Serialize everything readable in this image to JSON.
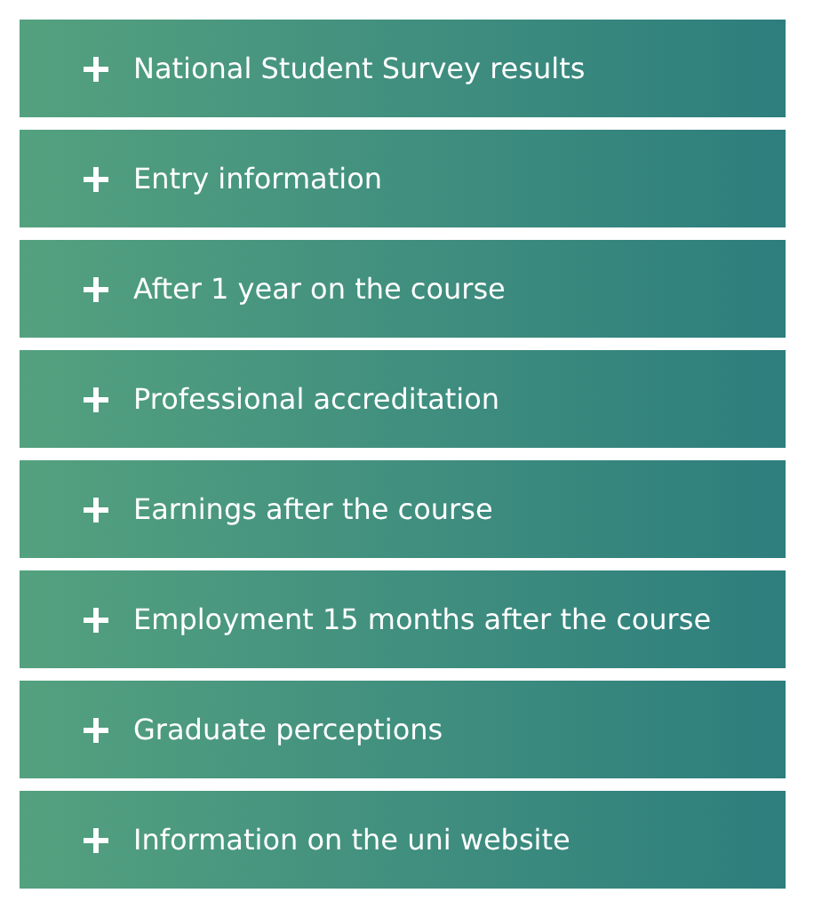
{
  "accordion": [
    {
      "label": "National Student Survey results",
      "expanded": false
    },
    {
      "label": "Entry information",
      "expanded": false
    },
    {
      "label": "After 1 year on the course",
      "expanded": false
    },
    {
      "label": "Professional accreditation",
      "expanded": false
    },
    {
      "label": "Earnings after the course",
      "expanded": false
    },
    {
      "label": "Employment 15 months after the course",
      "expanded": false
    },
    {
      "label": "Graduate perceptions",
      "expanded": false
    },
    {
      "label": "Information on the uni website",
      "expanded": false
    }
  ]
}
